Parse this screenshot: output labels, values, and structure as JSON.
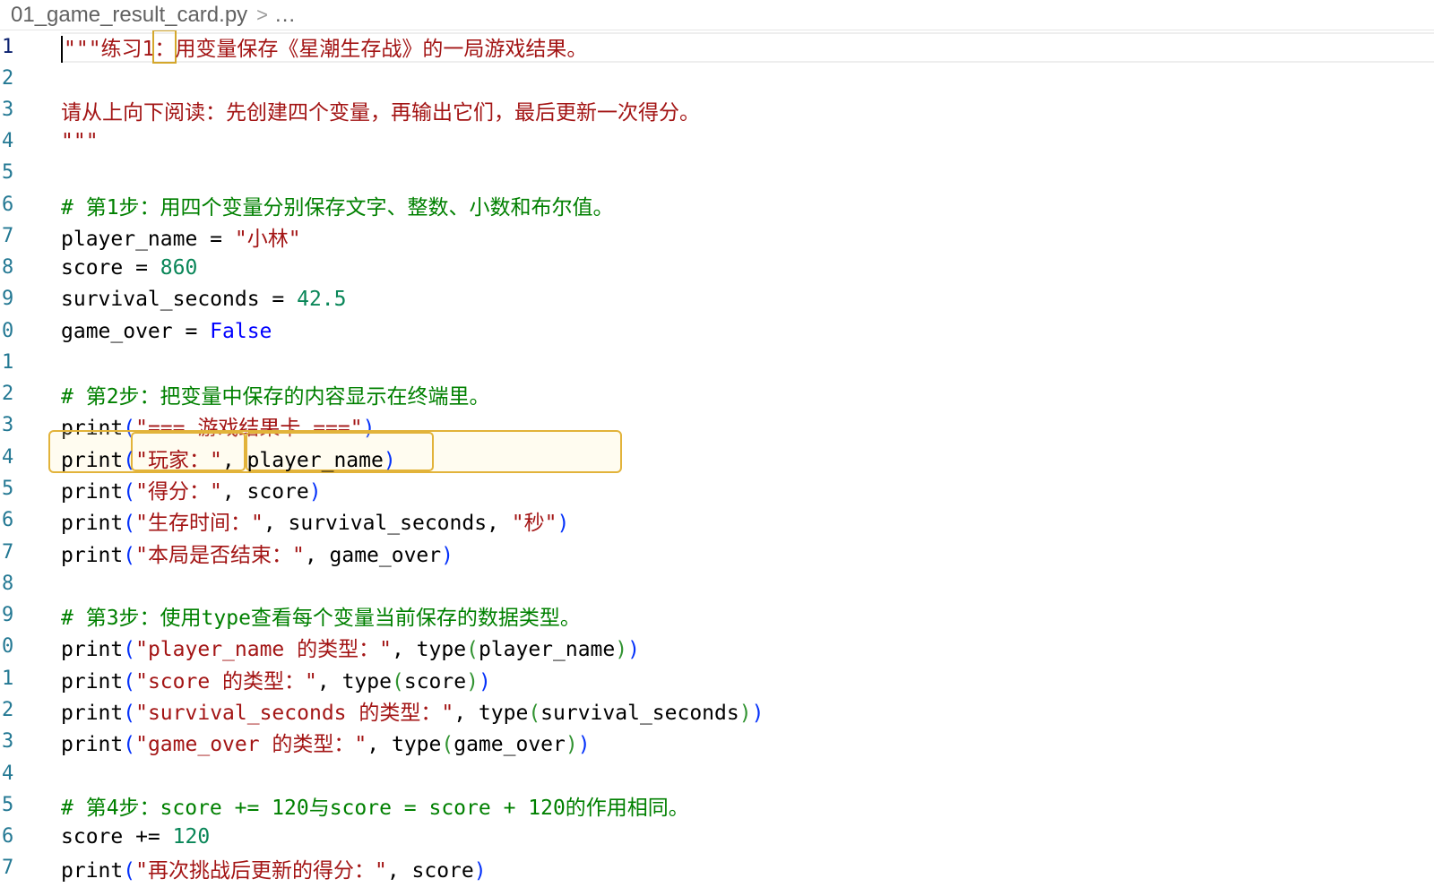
{
  "breadcrumb": {
    "file": "01_game_result_card.py",
    "separator": ">",
    "more": "..."
  },
  "lines": {
    "n1": "1",
    "n2": "2",
    "n3": "3",
    "n4": "4",
    "n5": "5",
    "n6": "6",
    "n7": "7",
    "n8": "8",
    "n9": "9",
    "n10": "0",
    "n11": "1",
    "n12": "2",
    "n13": "3",
    "n14": "4",
    "n15": "5",
    "n16": "6",
    "n17": "7",
    "n18": "8",
    "n19": "9",
    "n20": "0",
    "n21": "1",
    "n22": "2",
    "n23": "3",
    "n24": "4",
    "n25": "5",
    "n26": "6",
    "n27": "7"
  },
  "code": {
    "l1a": "\"\"\"练习1",
    "l1b": "：",
    "l1c": "用变量保存《星潮生存战》的一局游戏结果。",
    "l3": "请从上向下阅读：先创建四个变量，再输出它们，最后更新一次得分。",
    "l4": "\"\"\"",
    "l6": "# 第1步：用四个变量分别保存文字、整数、小数和布尔值。",
    "l7a": "player_name = ",
    "l7b": "\"小林\"",
    "l8a": "score = ",
    "l8b": "860",
    "l9a": "survival_seconds = ",
    "l9b": "42.5",
    "l10a": "game_over = ",
    "l10b": "False",
    "l12": "# 第2步：把变量中保存的内容显示在终端里。",
    "l13a": "print",
    "l13b": "(",
    "l13c": "\"=== 游戏结果卡 ===\"",
    "l13d": ")",
    "l14a": "print",
    "l14b": "(",
    "l14c": "\"玩家：\"",
    "l14d": ", ",
    "l14e": "player_name",
    "l14f": ")",
    "l15a": "print",
    "l15b": "(",
    "l15c": "\"得分：\"",
    "l15d": ", score",
    "l15e": ")",
    "l16a": "print",
    "l16b": "(",
    "l16c": "\"生存时间：\"",
    "l16d": ", survival_seconds, ",
    "l16e": "\"秒\"",
    "l16f": ")",
    "l17a": "print",
    "l17b": "(",
    "l17c": "\"本局是否结束：\"",
    "l17d": ", game_over",
    "l17e": ")",
    "l19": "# 第3步：使用type查看每个变量当前保存的数据类型。",
    "l20a": "print",
    "l20b": "(",
    "l20c": "\"player_name 的类型：\"",
    "l20d": ", type",
    "l20e": "(",
    "l20f": "player_name",
    "l20g": ")",
    "l20h": ")",
    "l21a": "print",
    "l21b": "(",
    "l21c": "\"score 的类型：\"",
    "l21d": ", type",
    "l21e": "(",
    "l21f": "score",
    "l21g": ")",
    "l21h": ")",
    "l22a": "print",
    "l22b": "(",
    "l22c": "\"survival_seconds 的类型：\"",
    "l22d": ", type",
    "l22e": "(",
    "l22f": "survival_seconds",
    "l22g": ")",
    "l22h": ")",
    "l23a": "print",
    "l23b": "(",
    "l23c": "\"game_over 的类型：\"",
    "l23d": ", type",
    "l23e": "(",
    "l23f": "game_over",
    "l23g": ")",
    "l23h": ")",
    "l25": "# 第4步：score += 120与score = score + 120的作用相同。",
    "l26a": "score += ",
    "l26b": "120",
    "l27a": "print",
    "l27b": "(",
    "l27c": "\"再次挑战后更新的得分：\"",
    "l27d": ", score",
    "l27e": ")"
  },
  "colors": {
    "string": "#a31515",
    "comment": "#008000",
    "number": "#098658",
    "keyword": "#0000ff",
    "line_number": "#237893",
    "bracket_highlight": "#e2b33a"
  }
}
